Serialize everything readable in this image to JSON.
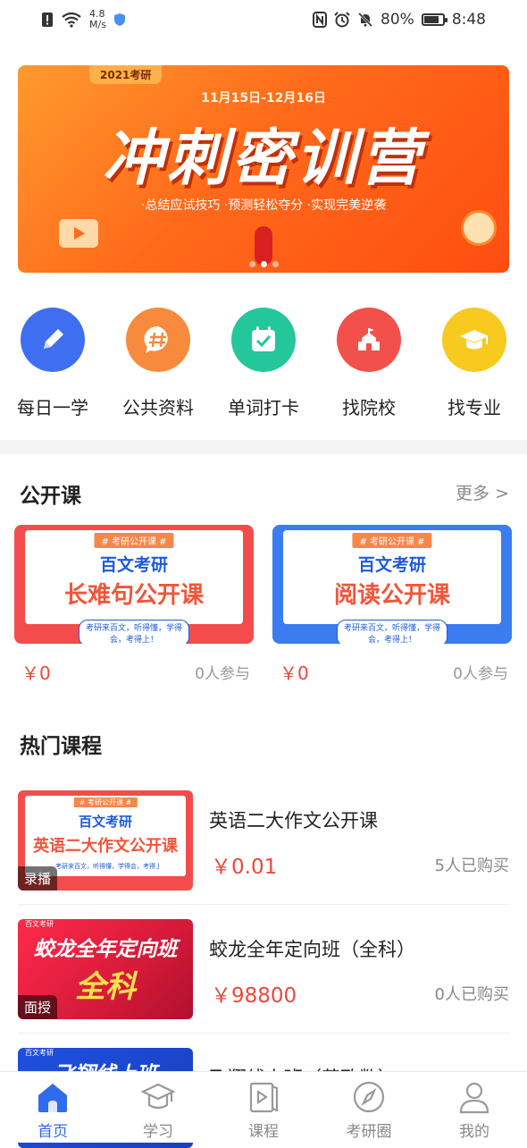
{
  "status_bar": {
    "speed_value": "4.8",
    "speed_unit": "M/s",
    "battery_pct": "80%",
    "battery_level": 0.8,
    "time": "8:48"
  },
  "banner": {
    "tag": "2021考研",
    "dates": "11月15日-12月16日",
    "title": "冲刺密训营",
    "subtitle": "·总结应试技巧  ·预测轻松夺分  ·实现完美逆袭",
    "page_count": 3,
    "active_page": 2
  },
  "quick_access": [
    {
      "label": "每日一学",
      "icon": "pencil-icon",
      "color": "#3f6ff0"
    },
    {
      "label": "公共资料",
      "icon": "hashtag-chat-icon",
      "color": "#f78a3c"
    },
    {
      "label": "单词打卡",
      "icon": "calendar-check-icon",
      "color": "#23c79b"
    },
    {
      "label": "找院校",
      "icon": "school-icon",
      "color": "#f2504a"
    },
    {
      "label": "找专业",
      "icon": "graduation-cap-icon",
      "color": "#f8c91e"
    }
  ],
  "open_courses": {
    "title": "公开课",
    "more": "更多 >",
    "items": [
      {
        "pill": "# 考研公开课 #",
        "brand": "百文考研",
        "title": "长难句公开课",
        "slogan": "考研来百文，听得懂，学得会，考得上！",
        "price": "￥0",
        "participants": "0人参与",
        "bg": "#f44c4c"
      },
      {
        "pill": "# 考研公开课 #",
        "brand": "百文考研",
        "title": "阅读公开课",
        "slogan": "考研来百文，听得懂，学得会，考得上！",
        "price": "￥0",
        "participants": "0人参与",
        "bg": "#3b7cf0"
      }
    ]
  },
  "hot_courses": {
    "title": "热门课程",
    "items": [
      {
        "thumb_pill": "# 考研公开课 #",
        "thumb_brand": "百文考研",
        "thumb_title": "英语二大作文公开课",
        "thumb_slogan": "考研来百文，听得懂，学得会，考得上！",
        "badge": "录播",
        "title": "英语二大作文公开课",
        "price": "￥0.01",
        "bought": "5人已购买"
      },
      {
        "thumb_brand": "百文考研",
        "thumb_title": "蛟龙全年定向班",
        "thumb_sub": "全科",
        "badge": "面授",
        "title": "蛟龙全年定向班（全科）",
        "price": "￥98800",
        "bought": "0人已购买"
      },
      {
        "thumb_brand": "百文考研",
        "thumb_title": "飞翔线上班",
        "title": "飞翔线上班（英政数）"
      }
    ]
  },
  "tab_bar": [
    {
      "label": "首页",
      "icon": "home-icon",
      "active": true
    },
    {
      "label": "学习",
      "icon": "mortarboard-icon",
      "active": false
    },
    {
      "label": "课程",
      "icon": "video-book-icon",
      "active": false
    },
    {
      "label": "考研圈",
      "icon": "compass-icon",
      "active": false
    },
    {
      "label": "我的",
      "icon": "user-icon",
      "active": false
    }
  ],
  "colors": {
    "accent": "#2f6bed",
    "price": "#e94a3c"
  }
}
